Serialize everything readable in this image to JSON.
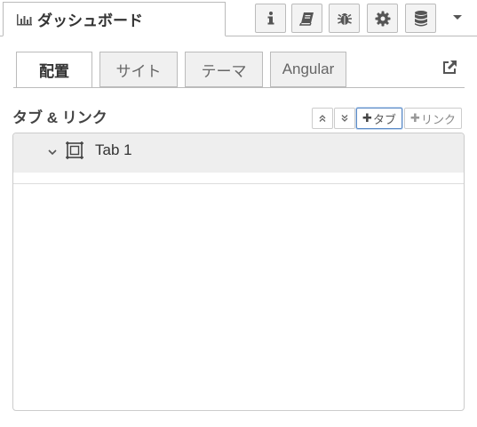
{
  "sidebar": {
    "title": "ダッシュボード",
    "icons": [
      "chart-bar-icon",
      "info-icon",
      "book-icon",
      "bug-icon",
      "gear-icon",
      "database-icon",
      "chevron-down-icon"
    ]
  },
  "tabs": [
    {
      "label": "配置",
      "active": true
    },
    {
      "label": "サイト",
      "active": false
    },
    {
      "label": "テーマ",
      "active": false
    },
    {
      "label": "Angular",
      "active": false
    }
  ],
  "section": {
    "title": "タブ & リンク",
    "collapse_all": "collapse-all-icon",
    "expand_all": "expand-all-icon",
    "add_tab_label": "タブ",
    "add_link_label": "リンク"
  },
  "tree": {
    "items": [
      {
        "label": "Tab 1",
        "icon": "tab-frame-icon",
        "expanded": true
      }
    ]
  },
  "colors": {
    "border": "#bbbbbb",
    "tab_inactive_bg": "#f0f0f0",
    "row_bg": "#eeeeee",
    "focus": "#5a8ac6"
  }
}
